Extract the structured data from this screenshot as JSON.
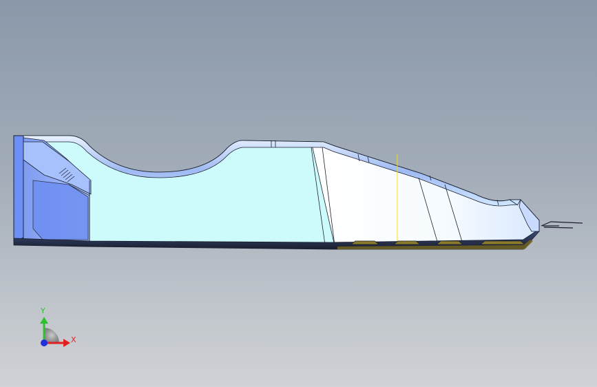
{
  "viewport": {
    "background_top": "#8a98a9",
    "background_bottom": "#cfd2d6"
  },
  "part": {
    "description_icon": "sheet-metal-part",
    "face_color_light": "#cdfbfb",
    "face_color_white": "#ffffff",
    "edge_color": "#1a1f2e",
    "fillet_color": "#8fb0f0",
    "shadow_blue": "#6d8ef2",
    "highlight_tab_color": "#8b7a2a",
    "yellow_line_color": "#f2e600"
  },
  "triad": {
    "x_label": "X",
    "y_label": "Y",
    "x_color": "#e02020",
    "y_color": "#2fc02f",
    "z_color": "#2030e0"
  }
}
